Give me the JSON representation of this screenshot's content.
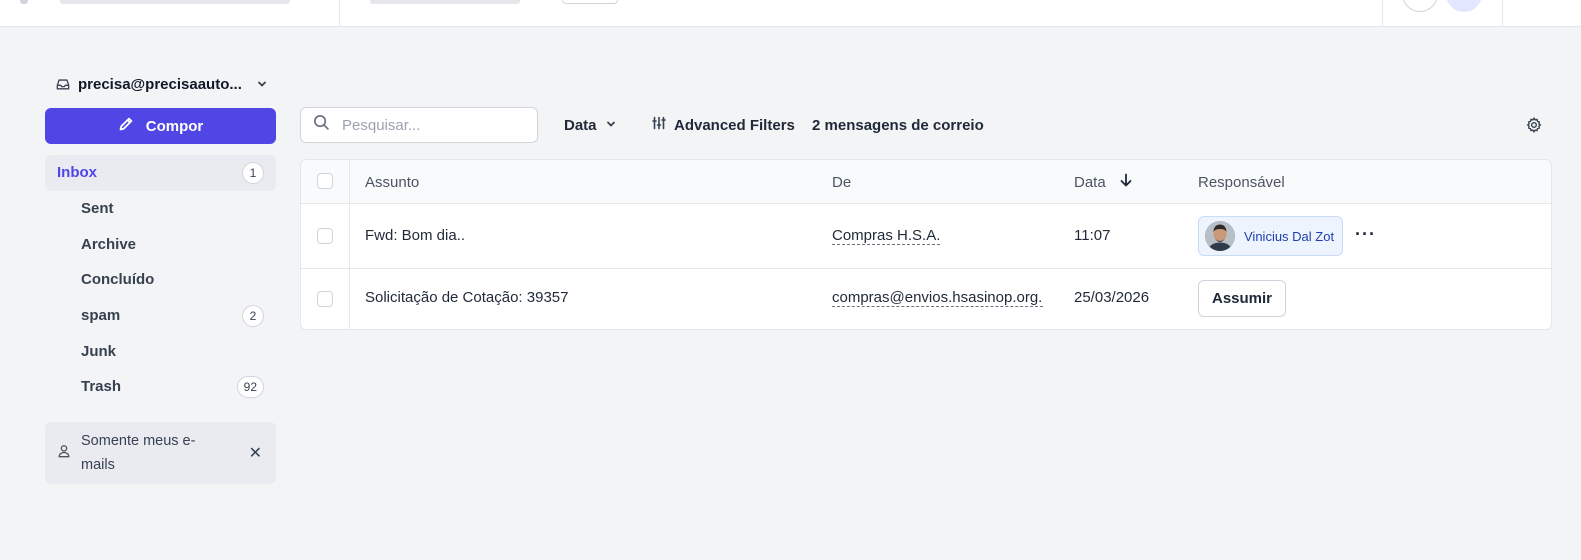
{
  "sidebar": {
    "account": "precisa@precisaauto...",
    "compose_label": "Compor",
    "folders": [
      {
        "label": "Inbox",
        "count": "1"
      },
      {
        "label": "Sent",
        "count": ""
      },
      {
        "label": "Archive",
        "count": ""
      },
      {
        "label": "Concluído",
        "count": ""
      },
      {
        "label": "spam",
        "count": "2"
      },
      {
        "label": "Junk",
        "count": ""
      },
      {
        "label": "Trash",
        "count": "92"
      }
    ],
    "filter_chip": "Somente meus e-mails"
  },
  "toolbar": {
    "search_placeholder": "Pesquisar...",
    "sort_label": "Data",
    "advanced_filters_label": "Advanced Filters",
    "message_count": "2 mensagens de correio"
  },
  "table": {
    "headers": {
      "subject": "Assunto",
      "from": "De",
      "date": "Data",
      "assignee": "Responsável"
    },
    "rows": [
      {
        "subject": "Fwd: Bom dia..",
        "from": "Compras H.S.A.",
        "date": "11:07",
        "assignee": "Vinicius Dal Zot",
        "assign_button": ""
      },
      {
        "subject": "Solicitação de Cotação: 39357",
        "from": "compras@envios.hsasinop.org.br",
        "date": "25/03/2026",
        "assignee": "",
        "assign_button": "Assumir"
      }
    ]
  },
  "colors": {
    "accent": "#4f46e5",
    "background": "#f3f4f6",
    "assignee_bg": "#eef4fd",
    "assignee_text": "#1e40af"
  },
  "icons": [
    "inbox-icon",
    "chevron-down-icon",
    "pencil-icon",
    "user-icon",
    "close-icon",
    "search-icon",
    "sliders-icon",
    "gear-icon",
    "arrow-down-icon",
    "more-horizontal-icon"
  ]
}
